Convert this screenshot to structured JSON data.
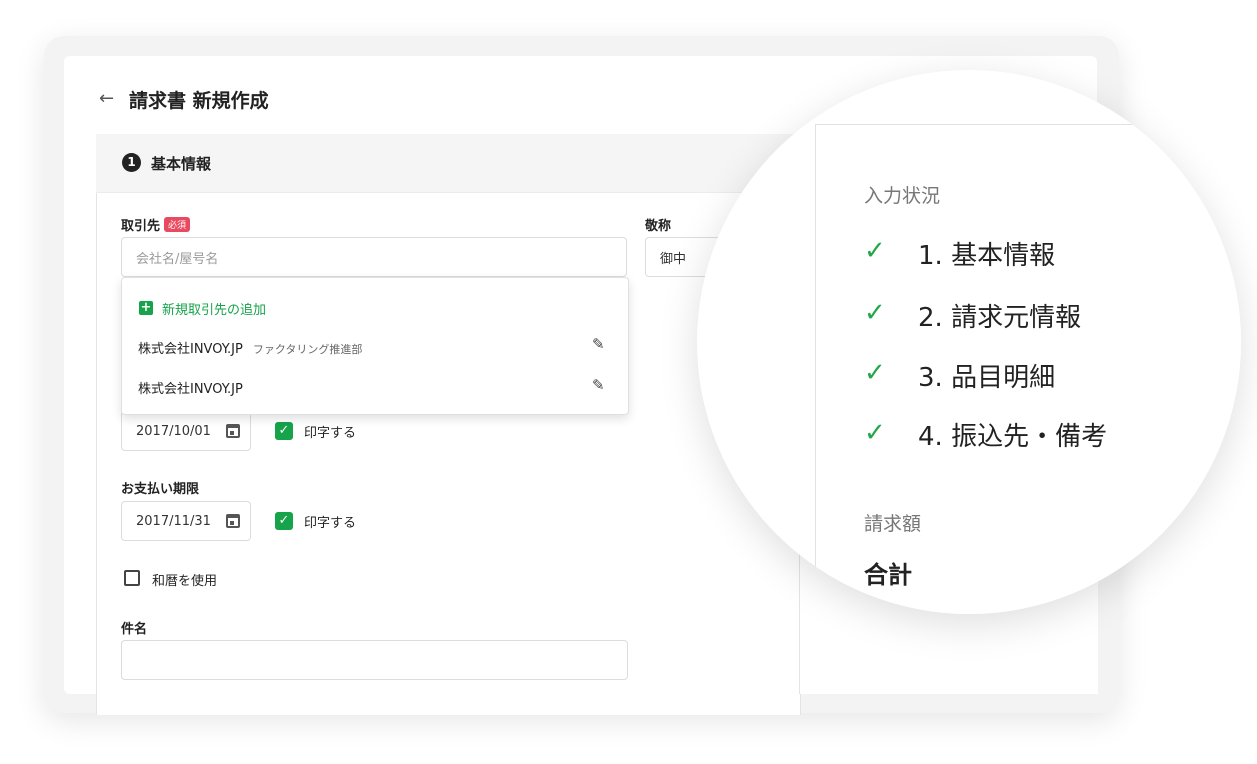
{
  "page": {
    "title": "請求書 新規作成"
  },
  "section": {
    "number": "1",
    "title": "基本情報"
  },
  "fields": {
    "client": {
      "label": "取引先",
      "required_badge": "必須",
      "placeholder": "会社名/屋号名"
    },
    "honorific": {
      "label": "敬称",
      "value": "御中"
    },
    "issue_date": {
      "value": "2017/10/01",
      "print_label": "印字する"
    },
    "due_date": {
      "label": "お支払い期限",
      "value": "2017/11/31",
      "print_label": "印字する"
    },
    "wareki": {
      "label": "和暦を使用"
    },
    "subject": {
      "label": "件名",
      "value": ""
    }
  },
  "dropdown": {
    "add_label": "新規取引先の追加",
    "items": [
      {
        "name": "株式会社INVOY.JP",
        "dept": "ファクタリング推進部"
      },
      {
        "name": "株式会社INVOY.JP",
        "dept": ""
      }
    ]
  },
  "status": {
    "heading": "入力状況",
    "steps": [
      "1. 基本情報",
      "2. 請求元情報",
      "3. 品目明細",
      "4. 振込先・備考"
    ],
    "amount_heading": "請求額",
    "total_label": "合計"
  },
  "colors": {
    "accent": "#16a34a",
    "required": "#e84a5f"
  }
}
